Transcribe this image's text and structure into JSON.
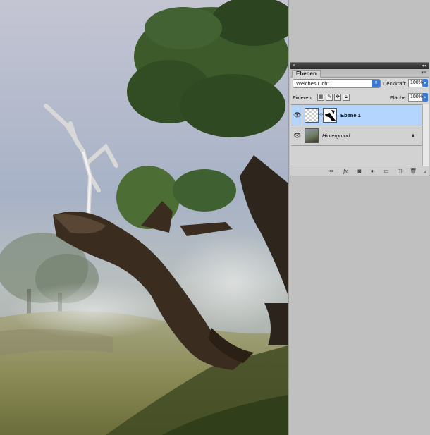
{
  "panel": {
    "tab_label": "Ebenen",
    "collapse_glyph": "◂◂",
    "close_glyph": "×",
    "menu_glyph": "▾≡",
    "blend_mode": "Weiches Licht",
    "opacity_label": "Deckkraft:",
    "opacity_value": "100%",
    "lock_label": "Fixieren:",
    "fill_label": "Fläche:",
    "fill_value": "100%",
    "layers": [
      {
        "name": "Ebene 1",
        "selected": true,
        "visible": true
      },
      {
        "name": "Hintergrund",
        "selected": false,
        "visible": true,
        "locked": true
      }
    ],
    "bottom_icons": [
      "link-icon",
      "fx-icon",
      "mask-icon",
      "adjustment-icon",
      "group-folder-icon",
      "new-layer-icon",
      "trash-icon"
    ],
    "fx_label": "fx."
  },
  "colors": {
    "selection": "#b4d5fe",
    "accent": "#3b7ad4",
    "workspace": "#c0c0c0"
  }
}
